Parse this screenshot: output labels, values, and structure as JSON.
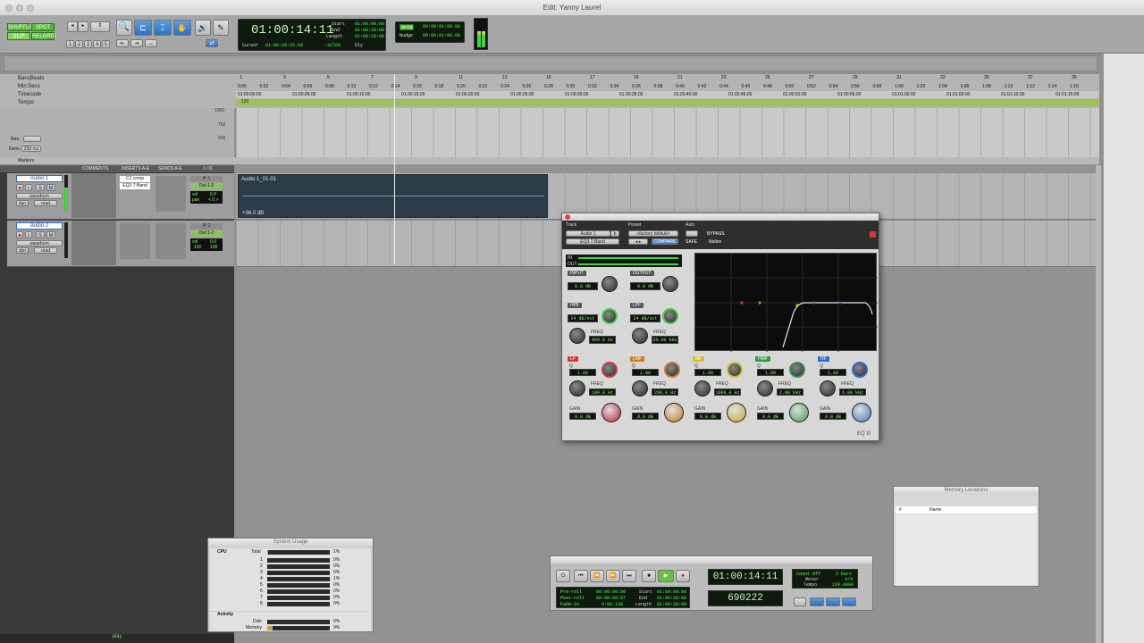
{
  "window": {
    "title": "Edit: Yanny Laurel"
  },
  "toolbar": {
    "modes": [
      "SHUFFLE",
      "SPOT",
      "SLIP",
      "GRID"
    ],
    "relgrid_label": "RELGRID",
    "grid_numbers": [
      "1",
      "2",
      "3",
      "4",
      "5"
    ],
    "main_counter": "01:00:14:11",
    "start_label": "Start",
    "end_label": "End",
    "length_label": "Length",
    "start": "01:00:00:08",
    "end": "01:00:28:09",
    "length": "01:00:28:00",
    "cursor_label": "Cursor",
    "cursor_value": "01:00:20:15.68",
    "cursor_sample": "-32768",
    "dly_label": "Dly",
    "grid_value": "00:00:01:00.00",
    "nudge_label": "Nudge",
    "nudge_value": "00:00:01:00.00",
    "grid_label": "Grid"
  },
  "rulers": {
    "labels": [
      "Bars|Beats",
      "Min:Secs",
      "Timecode",
      "Tempo"
    ],
    "bars": [
      "1",
      "3",
      "5",
      "7",
      "9",
      "11",
      "13",
      "15",
      "17",
      "19",
      "21",
      "23",
      "25",
      "27",
      "29",
      "31",
      "33",
      "35",
      "37",
      "39"
    ],
    "minsecs": [
      "0:00",
      "0:02",
      "0:04",
      "0:06",
      "0:08",
      "0:10",
      "0:12",
      "0:14",
      "0:16",
      "0:18",
      "0:20",
      "0:22",
      "0:24",
      "0:26",
      "0:28",
      "0:30",
      "0:32",
      "0:34",
      "0:36",
      "0:38",
      "0:40",
      "0:42",
      "0:44",
      "0:46",
      "0:48",
      "0:50",
      "0:52",
      "0:54",
      "0:56",
      "0:58",
      "1:00",
      "1:02",
      "1:04",
      "1:06",
      "1:08",
      "1:10",
      "1:12",
      "1:14",
      "1:16"
    ],
    "timecodes": [
      "01:00:00:00",
      "01:00:05:00",
      "01:00:10:00",
      "01:00:15:00",
      "01:00:20:00",
      "01:00:25:00",
      "01:00:30:00",
      "01:00:35:00",
      "01:00:40:00",
      "01:00:45:00",
      "01:00:50:00",
      "01:00:55:00",
      "01:01:00:00",
      "01:01:05:00",
      "01:01:10:00",
      "01:01:15:00"
    ],
    "tempo_value": "120",
    "tempo_scale": [
      "1000",
      "750",
      "500"
    ],
    "res_label": "Res:",
    "dens_label": "Dens:",
    "dens_value": "250 ms",
    "markers_label": "Markers"
  },
  "columns": {
    "comments": "COMMENTS",
    "inserts": "INSERTS A-E",
    "sends": "SENDS A-E",
    "io": "I / O"
  },
  "tracks": [
    {
      "name": "Audio 1",
      "view": "waveform",
      "auto": "read",
      "dyn": "dyn",
      "inserts": [
        "C1 comp",
        "EQ3 7-Band"
      ],
      "input": "IP 1",
      "output": "Out 1-2",
      "vol": "0.0",
      "pan": "< 0 >",
      "vol_label": "vol",
      "pan_label": "pan",
      "region_name": "Audio 1_01-01",
      "region_gain": "+36.0 dB"
    },
    {
      "name": "Audio 2",
      "view": "waveform",
      "auto": "read",
      "dyn": "dyn",
      "inserts": [],
      "input": "IP 2",
      "output": "Out 1-2",
      "vol": "0.0",
      "pan": "100",
      "pan2": "100",
      "vol_label": "vol"
    }
  ],
  "plugin": {
    "track_label": "Track",
    "preset_label": "Preset",
    "auto_label": "Auto",
    "track_name": "Audio 1",
    "track_b": "b",
    "preset_name": "<factory default>",
    "plugin_name": "EQ3 7-Band",
    "compare": "COMPARE",
    "bypass": "BYPASS",
    "safe": "SAFE",
    "native": "Native",
    "meter_in": "IN",
    "meter_out": "OUT",
    "input_label": "INPUT",
    "input_value": "0.0 dB",
    "output_label": "OUTPUT",
    "output_value": "0.0 dB",
    "hpf_label": "HPF",
    "hpf_slope": "24 dB/oct",
    "hpf_freq_label": "FREQ",
    "hpf_freq": "968.0 Hz",
    "lpf_label": "LPF",
    "lpf_slope": "24 dB/oct",
    "lpf_freq_label": "FREQ",
    "lpf_freq": "20.00 kHz",
    "bands": [
      {
        "name": "LF",
        "color": "#d23b3b",
        "q": "1.00",
        "freq": "100.0 Hz",
        "gain": "0.0 dB",
        "knob": "#b3232f"
      },
      {
        "name": "LMF",
        "color": "#d07a22",
        "q": "1.00",
        "freq": "200.0 Hz",
        "gain": "0.0 dB",
        "knob": "#c77724"
      },
      {
        "name": "MF",
        "color": "#d2c12c",
        "q": "1.00",
        "freq": "1000.0 Hz",
        "gain": "0.0 dB",
        "knob": "#c2ad28"
      },
      {
        "name": "HMF",
        "color": "#2f9a45",
        "q": "1.00",
        "freq": "2.00 kHz",
        "gain": "0.0 dB",
        "knob": "#3b9e4e"
      },
      {
        "name": "HF",
        "color": "#2c6ec7",
        "q": "1.00",
        "freq": "6.00 kHz",
        "gain": "0.0 dB",
        "knob": "#3f79c4"
      }
    ],
    "q_label": "Q",
    "freq_label": "FREQ",
    "gain_label": "GAIN",
    "footer_logo": "EQ III"
  },
  "system_usage": {
    "title": "System Usage",
    "cpu_label": "CPU",
    "total_label": "Total",
    "total_pct": "1%",
    "cores": [
      {
        "id": "1",
        "pct": "0%"
      },
      {
        "id": "2",
        "pct": "0%"
      },
      {
        "id": "3",
        "pct": "0%"
      },
      {
        "id": "4",
        "pct": "1%"
      },
      {
        "id": "5",
        "pct": "0%"
      },
      {
        "id": "6",
        "pct": "0%"
      },
      {
        "id": "7",
        "pct": "0%"
      },
      {
        "id": "8",
        "pct": "0%"
      }
    ],
    "activity_label": "Activity",
    "disk_label": "Disk",
    "disk_pct": "0%",
    "memory_label": "Memory",
    "memory_pct": "9%",
    "memory_fill": 0.09
  },
  "transport": {
    "counter": "01:00:14:11",
    "samples": "690222",
    "preroll_label": "Pre-roll",
    "preroll": "00:00:00:00",
    "postroll_label": "Post-roll",
    "postroll": "00:00:08:07",
    "fadein_label": "Fade-in",
    "fadein": "0:00.138",
    "start_label": "Start",
    "start": "01:00:00:08",
    "end_label": "End",
    "end": "01:00:28:09",
    "length_label": "Length",
    "length": "01:00:28:00",
    "countoff": "Count Off",
    "countoff_value": "2 bars",
    "meter": "Meter",
    "meter_value": "4/4",
    "tempo": "Tempo",
    "tempo_value": "120.0000"
  },
  "memory_locations": {
    "title": "Memory Locations",
    "col_num": "#",
    "col_name": "Name"
  },
  "status": {
    "play": "play"
  }
}
